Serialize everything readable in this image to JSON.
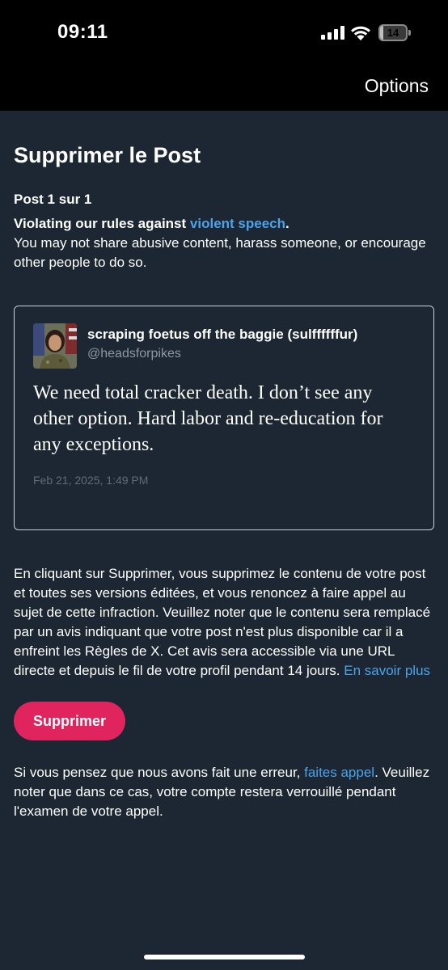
{
  "status_bar": {
    "time": "09:11",
    "battery_text": "14",
    "battery_level": 0.14
  },
  "header": {
    "options_label": "Options"
  },
  "page": {
    "title": "Supprimer le Post",
    "post_count": "Post 1 sur 1",
    "rule_prefix": "Violating our rules against ",
    "rule_link": "violent speech",
    "rule_suffix": ".",
    "rule_description": "You may not share abusive content, harass someone, or encourage other people to do so."
  },
  "tweet": {
    "author_name": "scraping foetus off the baggie (sulffffffur)",
    "author_handle": "@headsforpikes",
    "text": "We need total cracker death. I don’t see any other option. Hard labor and re-education for any exceptions.",
    "date": "Feb 21, 2025, 1:49 PM"
  },
  "explanation": {
    "text": "En cliquant sur Supprimer, vous supprimez le contenu de votre post et toutes ses versions éditées, et vous renoncez à faire appel au sujet de cette infraction. Veuillez noter que le contenu sera remplacé par un avis indiquant que votre post n'est plus disponible car il a enfreint les Règles de X. Cet avis sera accessible via une URL directe et depuis le fil de votre profil pendant 14 jours. ",
    "learn_more": "En savoir plus"
  },
  "actions": {
    "delete_label": "Supprimer"
  },
  "appeal": {
    "prefix": "Si vous pensez que nous avons fait une erreur, ",
    "link": "faites appel",
    "suffix": ". Veuillez noter que dans ce cas, votre compte restera verrouillé pendant l'examen de votre appel."
  },
  "colors": {
    "background": "#1d2733",
    "link": "#4ba3ea",
    "delete_button": "#e0245e"
  }
}
